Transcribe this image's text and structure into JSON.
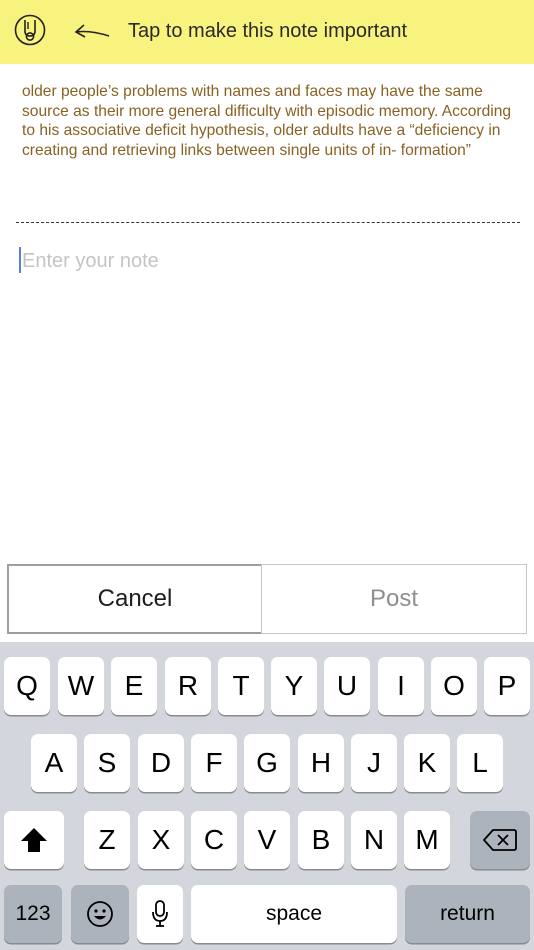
{
  "banner": {
    "badge_icon": "marker-badge-icon",
    "arrow_icon": "left-arrow-icon",
    "text": "Tap to make this note important",
    "background": "#f8f37e"
  },
  "quote": {
    "text": "older people’s problems with names and faces may have the same source as their more general difficulty with episodic memory. According to his associative deficit hypothesis, older adults have a “deficiency in creating and retrieving links between single units of in- formation”",
    "color": "#8a6124"
  },
  "note": {
    "value": "",
    "placeholder": "Enter your note"
  },
  "actions": {
    "cancel_label": "Cancel",
    "post_label": "Post"
  },
  "keyboard": {
    "row1": [
      "Q",
      "W",
      "E",
      "R",
      "T",
      "Y",
      "U",
      "I",
      "O",
      "P"
    ],
    "row2": [
      "A",
      "S",
      "D",
      "F",
      "G",
      "H",
      "J",
      "K",
      "L"
    ],
    "row3": [
      "Z",
      "X",
      "C",
      "V",
      "B",
      "N",
      "M"
    ],
    "shift_icon": "shift-icon",
    "backspace_icon": "backspace-icon",
    "numbers_label": "123",
    "emoji_icon": "emoji-icon",
    "mic_icon": "microphone-icon",
    "space_label": "space",
    "return_label": "return"
  }
}
